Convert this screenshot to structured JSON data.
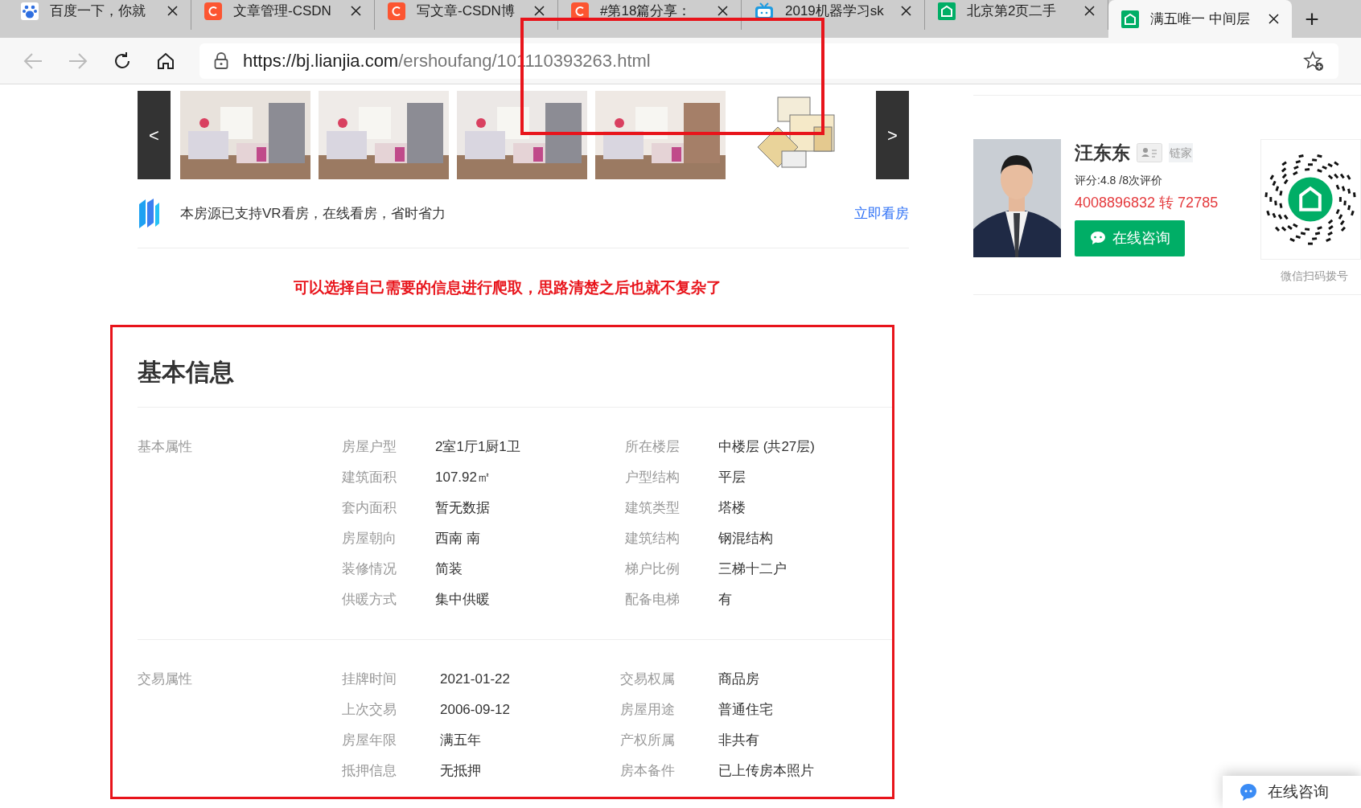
{
  "browser": {
    "tabs": [
      {
        "title": "百度一下，你就",
        "kind": "paw",
        "selected": false
      },
      {
        "title": "文章管理-CSDN",
        "kind": "c",
        "selected": false
      },
      {
        "title": "写文章-CSDN博",
        "kind": "c",
        "selected": false
      },
      {
        "title": "#第18篇分享：",
        "kind": "c",
        "selected": false
      },
      {
        "title": "2019机器学习sk",
        "kind": "tv",
        "selected": false
      },
      {
        "title": "北京第2页二手",
        "kind": "house",
        "selected": false
      },
      {
        "title": "满五唯一 中间层",
        "kind": "house",
        "selected": true
      }
    ],
    "new_tab": "+",
    "url": {
      "host": "https://bj.lianjia.com",
      "path": "/ershoufang/101110393263.html"
    }
  },
  "gallery": {
    "prev": "<",
    "next": ">",
    "items": [
      {
        "kind": "picture"
      },
      {
        "kind": "picture"
      },
      {
        "kind": "picture"
      },
      {
        "kind": "picture"
      },
      {
        "kind": "floorplan"
      }
    ]
  },
  "vr_notice": {
    "text": "本房源已支持VR看房，在线看房，省时省力",
    "link": "立即看房"
  },
  "annotation": "可以选择自己需要的信息进行爬取，思路清楚之后也就不复杂了",
  "basic_info": {
    "title": "基本信息",
    "sections": [
      {
        "label": "基本属性",
        "rows": [
          [
            "房屋户型",
            "2室1厅1厨1卫",
            "所在楼层",
            "中楼层 (共27层)"
          ],
          [
            "建筑面积",
            "107.92㎡",
            "户型结构",
            "平层"
          ],
          [
            "套内面积",
            "暂无数据",
            "建筑类型",
            "塔楼"
          ],
          [
            "房屋朝向",
            "西南 南",
            "建筑结构",
            "钢混结构"
          ],
          [
            "装修情况",
            "简装",
            "梯户比例",
            "三梯十二户"
          ],
          [
            "供暖方式",
            "集中供暖",
            "配备电梯",
            "有"
          ]
        ]
      },
      {
        "label": "交易属性",
        "rows": [
          [
            "挂牌时间",
            "2021-01-22",
            "交易权属",
            "商品房"
          ],
          [
            "上次交易",
            "2006-09-12",
            "房屋用途",
            "普通住宅"
          ],
          [
            "房屋年限",
            "满五年",
            "产权所属",
            "非共有"
          ],
          [
            "抵押信息",
            "无抵押",
            "房本备件",
            "已上传房本照片"
          ]
        ]
      }
    ]
  },
  "agent": {
    "name": "汪东东",
    "brand": "链家",
    "rating": "评分:4.8 /8次评价",
    "phone": "4008896832 转 72785",
    "consult": "在线咨询",
    "qr_caption": "微信扫码拨号"
  },
  "float_consult": "在线咨询"
}
